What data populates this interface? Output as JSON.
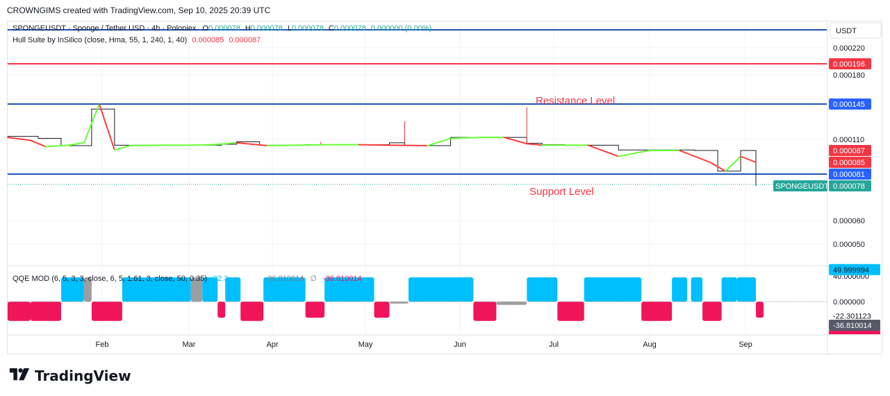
{
  "header": {
    "attribution": "CROWNGIMS created with TradingView.com, Sep 10, 2025 20:39 UTC"
  },
  "legend": {
    "symbol": "SPONGEUSDT · Sponge / Tether USD · 4h · Poloniex",
    "o_label": "O",
    "o_value": "0.000078",
    "h_label": "H",
    "h_value": "0.000078",
    "l_label": "L",
    "l_value": "0.000078",
    "c_label": "C",
    "c_value": "0.000078",
    "change": "0.000000 (0.00%)",
    "hull_name": "Hull Suite by InSilico (close, Hma, 55, 1, 240, 1, 40)",
    "hull_v1": "0.000085",
    "hull_v2": "0.000087"
  },
  "qqe_legend": {
    "name": "QQE MOD (6, 5, 3, 3, close, 6, 5, 1.61, 3, close, 50, 0.35)",
    "v1": "22.3",
    "v2": "-36.810014",
    "sep": "∅",
    "v3": "-36.810014"
  },
  "annotations": {
    "resistance": "Resistance Level",
    "support": "Support Level"
  },
  "brand": {
    "name": "TradingView"
  },
  "colors": {
    "blue_line": "#1e53b9",
    "red_line": "#f23645",
    "label_blue": "#2962ff",
    "label_red": "#f23645",
    "label_teal": "#26a69a",
    "hull_green": "#66ff33",
    "hull_red": "#ff3b3b",
    "qqe_up": "#00bfff",
    "qqe_down": "#f0145a",
    "qqe_neutral": "#9e9e9e",
    "annotation": "#f23645"
  },
  "chart_data": [
    {
      "type": "line",
      "name": "price-panel",
      "currency": "USDT",
      "y_ticks": [
        "0.000220",
        "0.000180",
        "0.000110",
        "0.000060",
        "0.000050"
      ],
      "y_tick_values": [
        0.00022,
        0.00018,
        0.00011,
        6e-05,
        5e-05
      ],
      "x_ticks": [
        "Feb",
        "Mar",
        "Apr",
        "May",
        "Jun",
        "Jul",
        "Aug",
        "Sep"
      ],
      "price_labels": [
        {
          "text": "0.000196",
          "value": 0.000196,
          "color": "red"
        },
        {
          "text": "0.000145",
          "value": 0.000145,
          "color": "blue"
        },
        {
          "text": "0.000087",
          "value": 8.7e-05,
          "color": "red"
        },
        {
          "text": "0.000085",
          "value": 8.5e-05,
          "color": "red"
        },
        {
          "text": "0.000081",
          "value": 8.1e-05,
          "color": "blue"
        },
        {
          "text": "0.000078",
          "value": 7.8e-05,
          "color": "teal",
          "symbol": "SPONGEUSDT"
        }
      ],
      "horizontal_lines": [
        {
          "value": 0.000232,
          "color": "blue"
        },
        {
          "value": 0.000196,
          "color": "red"
        },
        {
          "value": 0.000145,
          "color": "blue"
        },
        {
          "value": 8.1e-05,
          "color": "blue"
        }
      ],
      "price_series": {
        "x": [
          0,
          0.04,
          0.07,
          0.1,
          0.11,
          0.13,
          0.14,
          0.18,
          0.22,
          0.26,
          0.28,
          0.3,
          0.33,
          0.35,
          0.39,
          0.42,
          0.45,
          0.48,
          0.5,
          0.52,
          0.56,
          0.58,
          0.61,
          0.65,
          0.68,
          0.7,
          0.73,
          0.76,
          0.8,
          0.84,
          0.87,
          0.9,
          0.93,
          0.96,
          0.98
        ],
        "y": [
          0.000113,
          0.000111,
          9.7e-05,
          9.7e-05,
          0.00014,
          0.00014,
          9.8e-05,
          9.8e-05,
          9.8e-05,
          9.8e-05,
          0.0001,
          0.000105,
          9.8e-05,
          9.8e-05,
          9.9e-05,
          9.9e-05,
          9.9e-05,
          9.9e-05,
          0.000103,
          9.7e-05,
          9.7e-05,
          0.000112,
          0.000112,
          0.000112,
          0.000102,
          9.9e-05,
          9.8e-05,
          9.8e-05,
          8.8e-05,
          8.8e-05,
          8.8e-05,
          8.7e-05,
          8.2e-05,
          8.7e-05,
          7.8e-05
        ]
      },
      "hull_series": {
        "x": [
          0,
          0.03,
          0.05,
          0.08,
          0.1,
          0.12,
          0.14,
          0.16,
          0.2,
          0.24,
          0.27,
          0.3,
          0.34,
          0.38,
          0.42,
          0.46,
          0.5,
          0.55,
          0.58,
          0.62,
          0.65,
          0.68,
          0.7,
          0.73,
          0.76,
          0.8,
          0.84,
          0.88,
          0.92,
          0.94,
          0.96,
          0.98
        ],
        "y": [
          0.000112,
          0.000108,
          9.5e-05,
          9.8e-05,
          0.000103,
          0.000145,
          8.8e-05,
          9.7e-05,
          9.8e-05,
          9.8e-05,
          9.9e-05,
          0.000103,
          9.7e-05,
          9.8e-05,
          9.9e-05,
          9.9e-05,
          9.8e-05,
          9.7e-05,
          0.000111,
          0.000112,
          0.000112,
          0.000101,
          9.8e-05,
          9.8e-05,
          9.8e-05,
          8.6e-05,
          8.7e-05,
          8.7e-05,
          8.5e-05,
          8.2e-05,
          8.6e-05,
          8.5e-05
        ]
      }
    },
    {
      "type": "bar",
      "name": "qqe-mod-panel",
      "y_ticks": [
        "40.000000",
        "0.000000",
        "-22.301123"
      ],
      "y_tick_values": [
        40,
        0,
        -22.301123
      ],
      "value_labels": [
        {
          "text": "49.999994",
          "value": 49.999994,
          "color": "blue"
        },
        {
          "text": "-36.810014",
          "value": -36.810014,
          "color": "gray"
        }
      ],
      "blocks": [
        {
          "start": 0.0,
          "end": 0.03,
          "value": -30,
          "color": "down"
        },
        {
          "start": 0.03,
          "end": 0.07,
          "value": -3,
          "color": "neutral"
        },
        {
          "start": 0.03,
          "end": 0.07,
          "value": -30,
          "color": "down"
        },
        {
          "start": 0.07,
          "end": 0.1,
          "value": 38,
          "color": "up"
        },
        {
          "start": 0.1,
          "end": 0.11,
          "value": 38,
          "color": "neutral"
        },
        {
          "start": 0.11,
          "end": 0.15,
          "value": -30,
          "color": "down"
        },
        {
          "start": 0.15,
          "end": 0.24,
          "value": 38,
          "color": "up"
        },
        {
          "start": 0.24,
          "end": 0.255,
          "value": 38,
          "color": "neutral"
        },
        {
          "start": 0.255,
          "end": 0.275,
          "value": 38,
          "color": "up"
        },
        {
          "start": 0.275,
          "end": 0.285,
          "value": -25,
          "color": "down"
        },
        {
          "start": 0.285,
          "end": 0.305,
          "value": 38,
          "color": "up"
        },
        {
          "start": 0.305,
          "end": 0.335,
          "value": -30,
          "color": "down"
        },
        {
          "start": 0.335,
          "end": 0.39,
          "value": 38,
          "color": "up"
        },
        {
          "start": 0.39,
          "end": 0.415,
          "value": -25,
          "color": "down"
        },
        {
          "start": 0.415,
          "end": 0.48,
          "value": 38,
          "color": "up"
        },
        {
          "start": 0.48,
          "end": 0.5,
          "value": -25,
          "color": "down"
        },
        {
          "start": 0.5,
          "end": 0.525,
          "value": -3,
          "color": "neutral"
        },
        {
          "start": 0.525,
          "end": 0.61,
          "value": 38,
          "color": "up"
        },
        {
          "start": 0.61,
          "end": 0.64,
          "value": -30,
          "color": "down"
        },
        {
          "start": 0.64,
          "end": 0.68,
          "value": -5,
          "color": "neutral"
        },
        {
          "start": 0.68,
          "end": 0.72,
          "value": 38,
          "color": "up"
        },
        {
          "start": 0.72,
          "end": 0.755,
          "value": -30,
          "color": "down"
        },
        {
          "start": 0.755,
          "end": 0.83,
          "value": 38,
          "color": "up"
        },
        {
          "start": 0.83,
          "end": 0.87,
          "value": -30,
          "color": "down"
        },
        {
          "start": 0.87,
          "end": 0.89,
          "value": 38,
          "color": "up"
        },
        {
          "start": 0.895,
          "end": 0.91,
          "value": 38,
          "color": "up"
        },
        {
          "start": 0.91,
          "end": 0.935,
          "value": -30,
          "color": "down"
        },
        {
          "start": 0.935,
          "end": 0.955,
          "value": 38,
          "color": "up"
        },
        {
          "start": 0.955,
          "end": 0.98,
          "value": 38,
          "color": "up"
        },
        {
          "start": 0.98,
          "end": 0.99,
          "value": -25,
          "color": "down"
        }
      ]
    }
  ]
}
